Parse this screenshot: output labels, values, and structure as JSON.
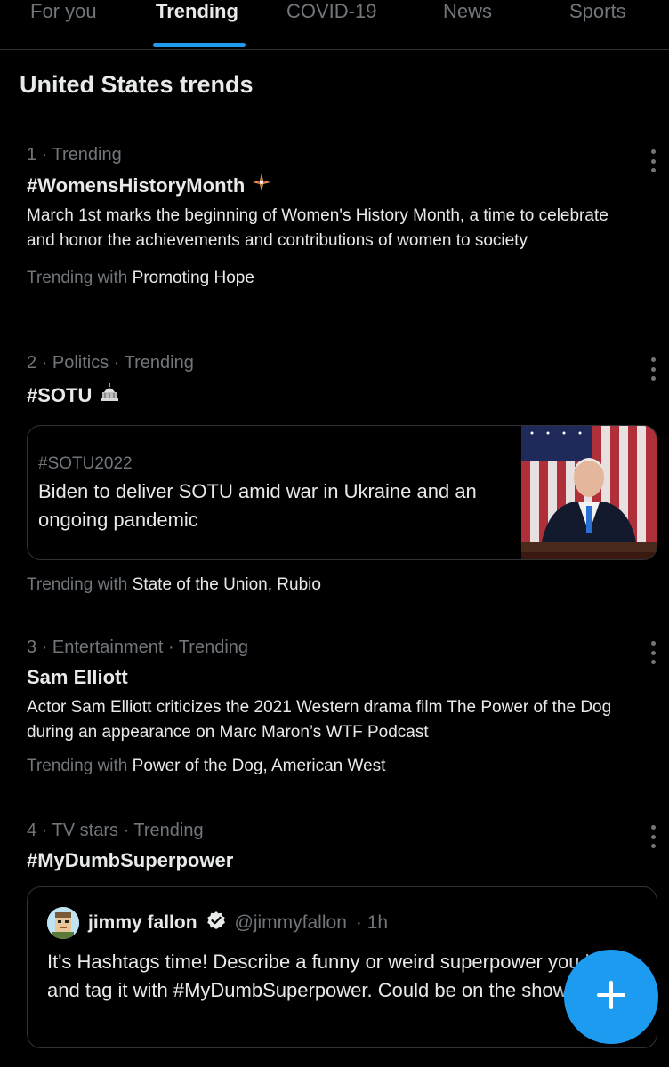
{
  "tabs": [
    {
      "label": "For you"
    },
    {
      "label": "Trending"
    },
    {
      "label": "COVID-19"
    },
    {
      "label": "News"
    },
    {
      "label": "Sports"
    }
  ],
  "section_title": "United States trends",
  "trends": [
    {
      "meta": "1 · Trending",
      "name": "#WomensHistoryMonth",
      "description": "March 1st marks the beginning of Women's History Month, a time to celebrate and honor the achievements and contributions of women to society",
      "with_label": "Trending with",
      "with_value": "Promoting Hope",
      "icon": "sparkle-star-icon"
    },
    {
      "meta": "2 · Politics · Trending",
      "name": "#SOTU",
      "with_label": "Trending with",
      "with_value": "State of the Union, Rubio",
      "icon": "capitol-icon",
      "card": {
        "tag": "#SOTU2022",
        "headline": "Biden to deliver SOTU amid war in Ukraine and an ongoing pandemic"
      }
    },
    {
      "meta": "3 · Entertainment · Trending",
      "name": "Sam Elliott",
      "description": "Actor Sam Elliott criticizes the 2021 Western drama film The Power of the Dog during an appearance on Marc Maron’s WTF Podcast",
      "with_label": "Trending with",
      "with_value": "Power of the Dog, American West"
    },
    {
      "meta": "4 · TV stars · Trending",
      "name": "#MyDumbSuperpower",
      "tweet": {
        "name": "jimmy fallon",
        "handle": "@jimmyfallon",
        "time": "· 1h",
        "text": "It's Hashtags time! Describe a funny or weird superpower you have and tag it with #MyDumbSuperpower. Could be on the show!"
      }
    }
  ],
  "colors": {
    "accent": "#1d9bf0",
    "background": "#000000",
    "muted": "#71767b",
    "text": "#e7e9ea"
  }
}
